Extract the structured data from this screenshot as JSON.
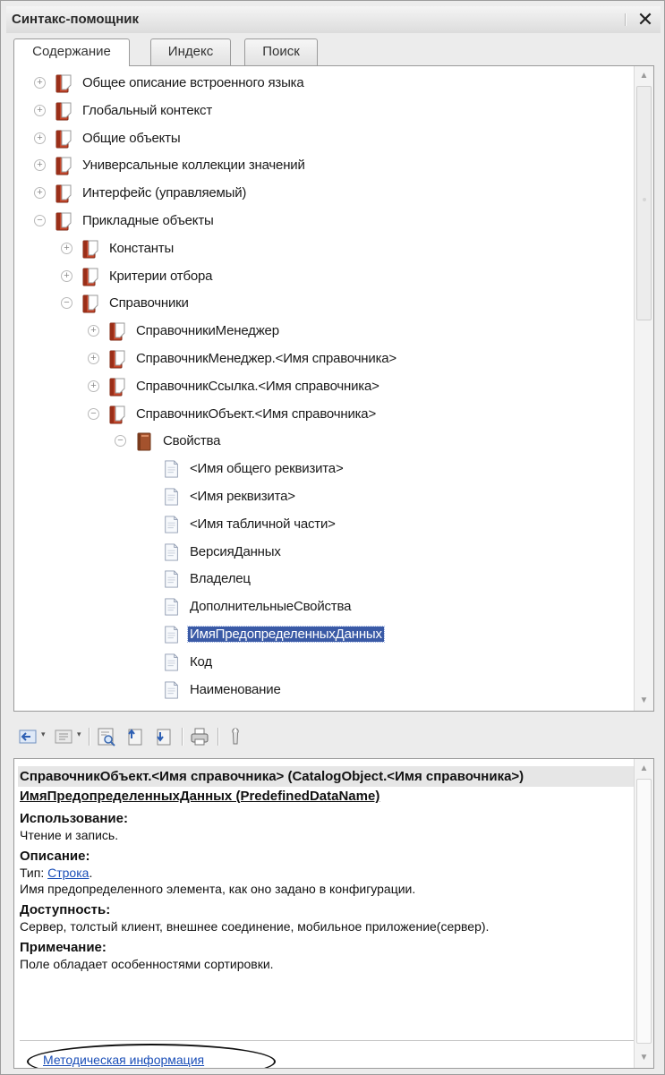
{
  "window": {
    "title": "Синтакс-помощник",
    "close_glyph": "✕"
  },
  "tabs": [
    {
      "label": "Содержание",
      "active": true
    },
    {
      "label": "Индекс",
      "active": false
    },
    {
      "label": "Поиск",
      "active": false
    }
  ],
  "tree": {
    "items": [
      {
        "label": "Общее описание встроенного языка",
        "level": 0,
        "icon": "book-icon",
        "expander": "plus"
      },
      {
        "label": "Глобальный контекст",
        "level": 0,
        "icon": "book-icon",
        "expander": "plus"
      },
      {
        "label": "Общие объекты",
        "level": 0,
        "icon": "book-icon",
        "expander": "plus"
      },
      {
        "label": "Универсальные коллекции значений",
        "level": 0,
        "icon": "book-icon",
        "expander": "plus"
      },
      {
        "label": "Интерфейс (управляемый)",
        "level": 0,
        "icon": "book-icon",
        "expander": "plus"
      },
      {
        "label": "Прикладные объекты",
        "level": 0,
        "icon": "book-icon",
        "expander": "minus"
      },
      {
        "label": "Константы",
        "level": 1,
        "icon": "book-icon",
        "expander": "plus"
      },
      {
        "label": "Критерии отбора",
        "level": 1,
        "icon": "book-icon",
        "expander": "plus"
      },
      {
        "label": "Справочники",
        "level": 1,
        "icon": "book-icon",
        "expander": "minus"
      },
      {
        "label": "СправочникиМенеджер",
        "level": 2,
        "icon": "book-icon",
        "expander": "plus"
      },
      {
        "label": "СправочникМенеджер.<Имя справочника>",
        "level": 2,
        "icon": "book-icon",
        "expander": "plus"
      },
      {
        "label": "СправочникСсылка.<Имя справочника>",
        "level": 2,
        "icon": "book-icon",
        "expander": "plus"
      },
      {
        "label": "СправочникОбъект.<Имя справочника>",
        "level": 2,
        "icon": "book-icon",
        "expander": "minus"
      },
      {
        "label": "Свойства",
        "level": 3,
        "icon": "closed-book-icon",
        "expander": "minus"
      },
      {
        "label": "<Имя общего реквизита>",
        "level": 4,
        "icon": "page-icon",
        "expander": "none"
      },
      {
        "label": "<Имя реквизита>",
        "level": 4,
        "icon": "page-icon",
        "expander": "none"
      },
      {
        "label": "<Имя табличной части>",
        "level": 4,
        "icon": "page-icon",
        "expander": "none"
      },
      {
        "label": "ВерсияДанных",
        "level": 4,
        "icon": "page-icon",
        "expander": "none"
      },
      {
        "label": "Владелец",
        "level": 4,
        "icon": "page-icon",
        "expander": "none"
      },
      {
        "label": "ДополнительныеСвойства",
        "level": 4,
        "icon": "page-icon",
        "expander": "none"
      },
      {
        "label": "ИмяПредопределенныхДанных",
        "level": 4,
        "icon": "page-icon",
        "expander": "none",
        "selected": true
      },
      {
        "label": "Код",
        "level": 4,
        "icon": "page-icon",
        "expander": "none"
      },
      {
        "label": "Наименование",
        "level": 4,
        "icon": "page-icon",
        "expander": "none"
      }
    ]
  },
  "toolbar": {
    "buttons": [
      "back-arrow-icon",
      "forward-arrow-icon",
      "find-in-tree-icon",
      "previous-topic-icon",
      "next-topic-icon",
      "print-icon",
      "settings-wrench-icon"
    ]
  },
  "description": {
    "header": "СправочникОбъект.<Имя справочника> (CatalogObject.<Имя справочника>)",
    "property": "ИмяПредопределенныхДанных (PredefinedDataName)",
    "usage_title": "Использование:",
    "usage_text": "Чтение и запись.",
    "desc_title": "Описание:",
    "type_prefix": "Тип: ",
    "type_link": "Строка",
    "type_suffix": ".",
    "desc_text": "Имя предопределенного элемента, как оно задано в конфигурации.",
    "avail_title": "Доступность:",
    "avail_text": "Сервер, толстый клиент, внешнее соединение, мобильное приложение(сервер).",
    "note_title": "Примечание:",
    "note_text": "Поле обладает особенностями сортировки.",
    "method_link": "Методическая информация"
  },
  "colors": {
    "selection": "#3a5aa6",
    "link": "#1b4fb8",
    "book_red": "#c8462a",
    "book_brown": "#a4522d"
  }
}
